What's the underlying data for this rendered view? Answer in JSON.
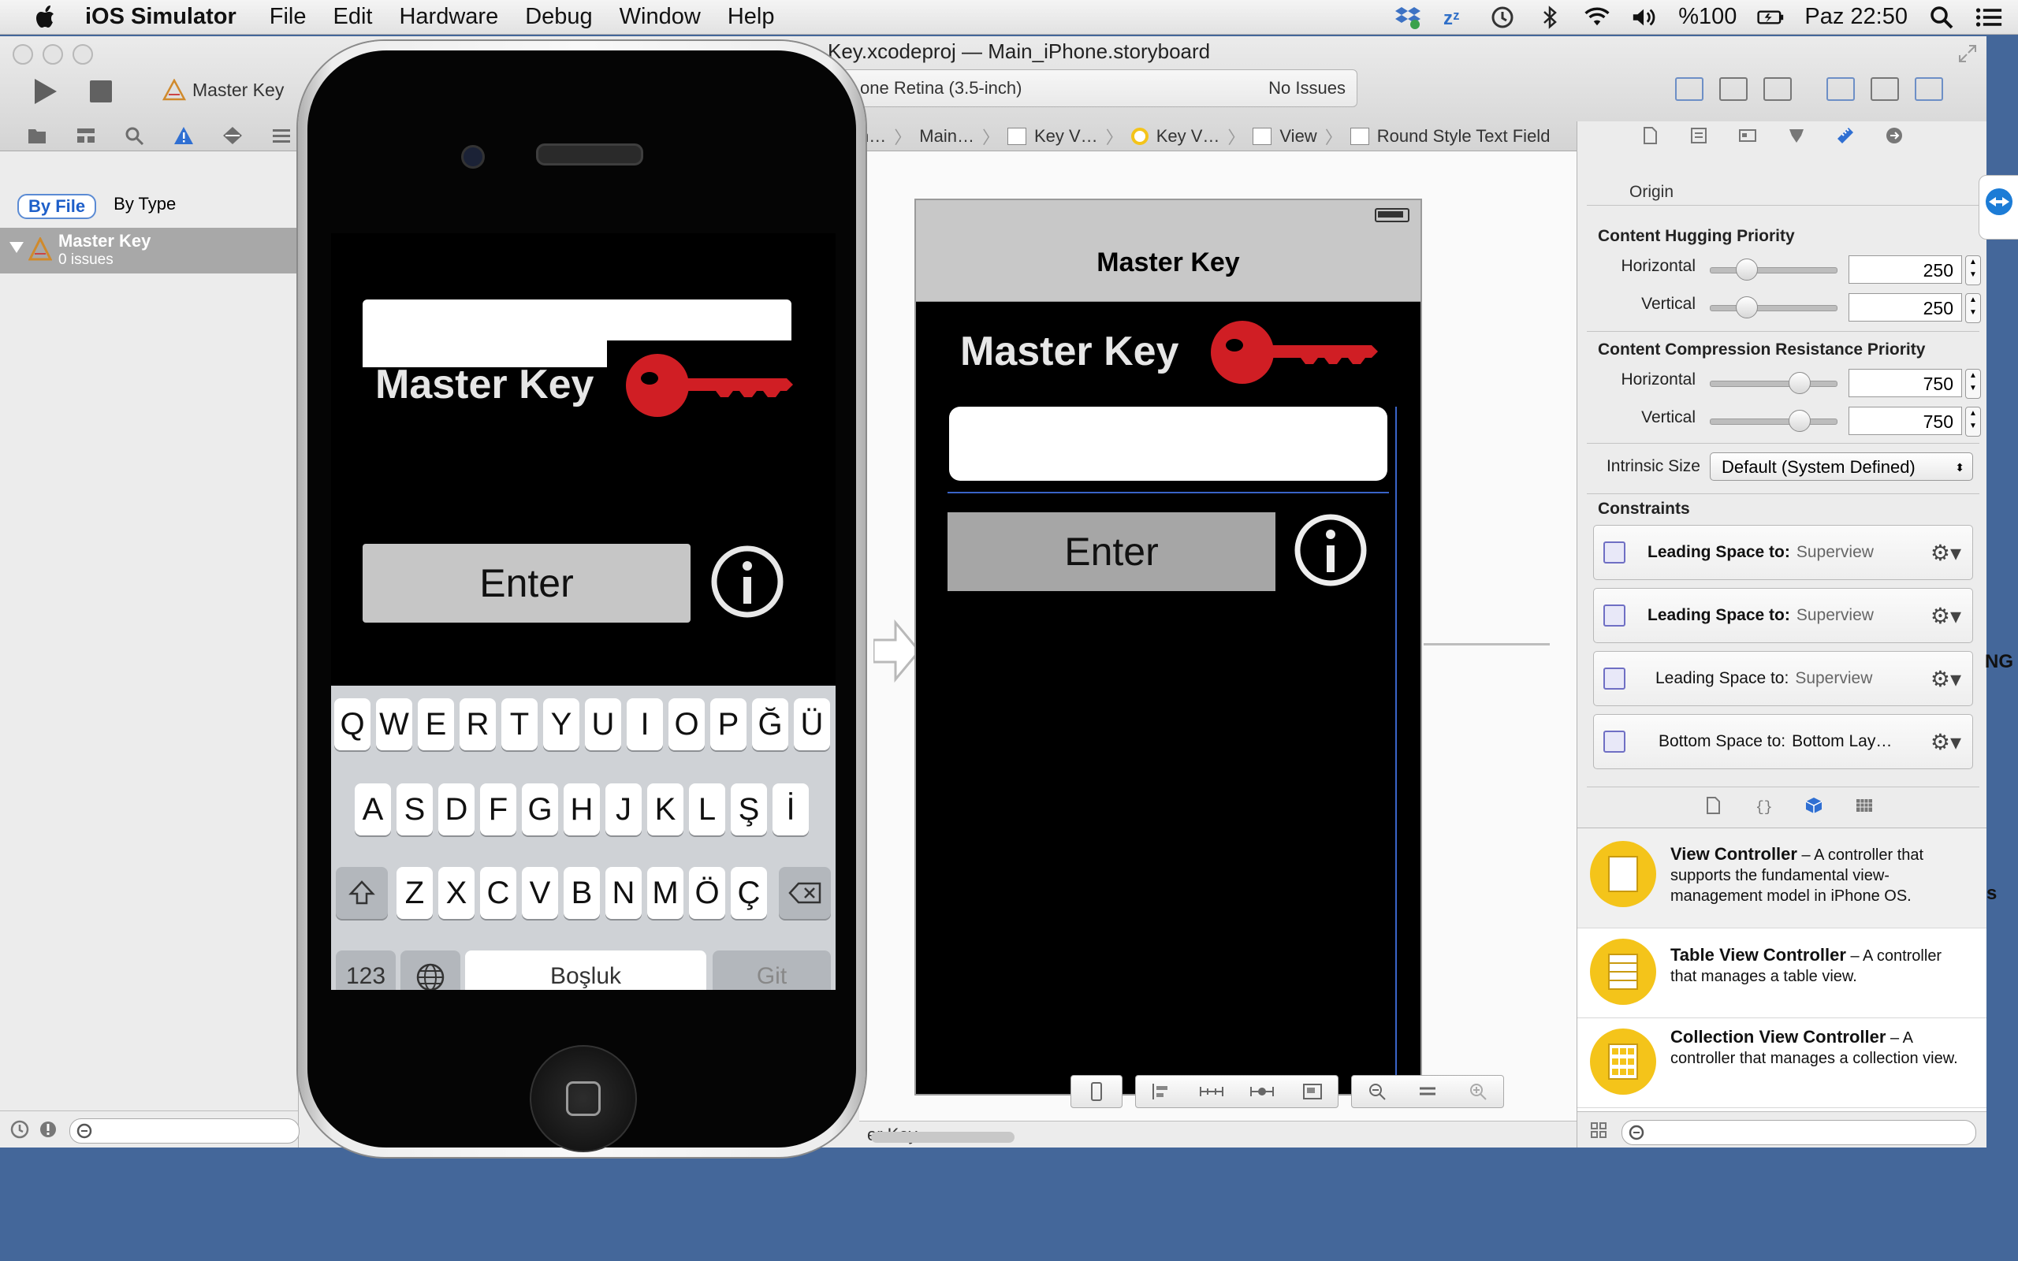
{
  "menubar": {
    "app_name": "iOS Simulator",
    "menus": [
      "File",
      "Edit",
      "Hardware",
      "Debug",
      "Window",
      "Help"
    ],
    "battery": "%100",
    "clock": "Paz 22:50"
  },
  "xcode": {
    "window_title": "Key.xcodeproj — Main_iPhone.storyboard",
    "scheme": "Master Key",
    "activity": {
      "device": "one Retina (3.5-inch)",
      "status": "No Issues"
    },
    "navigator": {
      "filter_by_file": "By File",
      "filter_by_type": "By Type",
      "project": "Master Key",
      "issues": "0 issues"
    },
    "jumpbar": [
      "n…",
      "Main…",
      "Key V…",
      "Key V…",
      "View",
      "Round Style Text Field"
    ],
    "editor_footer": "er Key"
  },
  "storyboard": {
    "nav_title": "Master Key",
    "title": "Master Key",
    "enter_label": "Enter"
  },
  "inspector": {
    "origin_label": "Origin",
    "hugging_title": "Content Hugging Priority",
    "compression_title": "Content Compression Resistance Priority",
    "horizontal_label": "Horizontal",
    "vertical_label": "Vertical",
    "hugging_h": "250",
    "hugging_v": "250",
    "compression_h": "750",
    "compression_v": "750",
    "hugging_h_level": 0.25,
    "hugging_v_level": 0.25,
    "compression_h_level": 0.75,
    "compression_v_level": 0.75,
    "intrinsic_label": "Intrinsic Size",
    "intrinsic_value": "Default (System Defined)",
    "constraints_title": "Constraints",
    "constraints": [
      {
        "label": "Leading Space to:",
        "target": "Superview",
        "bold": true
      },
      {
        "label": "Leading Space to:",
        "target": "Superview",
        "bold": true
      },
      {
        "label": "Leading Space to:",
        "target": "Superview",
        "bold": false
      },
      {
        "label": "Bottom Space to:",
        "target": "Bottom Lay…",
        "bold": false
      }
    ]
  },
  "library": [
    {
      "name": "View Controller",
      "desc": "A controller that supports the fundamental view-management model in iPhone OS."
    },
    {
      "name": "Table View Controller",
      "desc": "A controller that manages a table view."
    },
    {
      "name": "Collection View Controller",
      "desc": "A controller that manages a collection view."
    }
  ],
  "edge_fragments": {
    "a": "NG",
    "b": "s"
  },
  "simulator": {
    "title": "Master Key",
    "enter_label": "Enter",
    "keyboard": {
      "row1": [
        "Q",
        "W",
        "E",
        "R",
        "T",
        "Y",
        "U",
        "I",
        "O",
        "P",
        "Ğ",
        "Ü"
      ],
      "row2": [
        "A",
        "S",
        "D",
        "F",
        "G",
        "H",
        "J",
        "K",
        "L",
        "Ş",
        "İ"
      ],
      "row3": [
        "Z",
        "X",
        "C",
        "V",
        "B",
        "N",
        "M",
        "Ö",
        "Ç"
      ],
      "numbers": "123",
      "space": "Boşluk",
      "go": "Git"
    }
  },
  "colors": {
    "desktop": "#44679a",
    "accent": "#3a64c8",
    "key_red": "#d01e24",
    "library_yellow": "#f4c41a"
  }
}
